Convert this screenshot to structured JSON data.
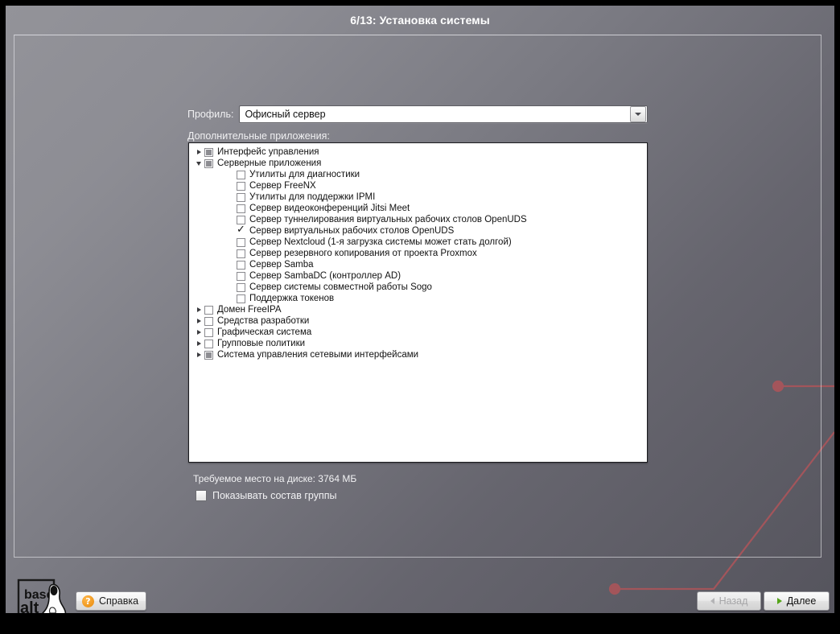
{
  "window": {
    "title": "6/13: Установка системы"
  },
  "form": {
    "profile_label": "Профиль:",
    "profile_value": "Офисный сервер",
    "combo_icon": "chevron-down-icon",
    "apps_label": "Дополнительные приложения:",
    "disk_space_text": "Требуемое место на диске: 3764 МБ",
    "show_group_label": "Показывать состав группы",
    "show_group_checked": false
  },
  "tree": [
    {
      "label": "Интерфейс управления",
      "level": 0,
      "twisty": "right",
      "state": "partial"
    },
    {
      "label": "Серверные приложения",
      "level": 0,
      "twisty": "down",
      "state": "partial"
    },
    {
      "label": "Утилиты для диагностики",
      "level": 1,
      "twisty": "none",
      "state": "unchecked"
    },
    {
      "label": "Сервер FreeNX",
      "level": 1,
      "twisty": "none",
      "state": "unchecked"
    },
    {
      "label": "Утилиты для поддержки IPMI",
      "level": 1,
      "twisty": "none",
      "state": "unchecked"
    },
    {
      "label": "Сервер видеоконференций Jitsi Meet",
      "level": 1,
      "twisty": "none",
      "state": "unchecked"
    },
    {
      "label": "Сервер туннелирования виртуальных рабочих столов OpenUDS",
      "level": 1,
      "twisty": "none",
      "state": "unchecked"
    },
    {
      "label": "Сервер виртуальных рабочих столов OpenUDS",
      "level": 1,
      "twisty": "none",
      "state": "checked"
    },
    {
      "label": "Сервер Nextcloud (1-я загрузка системы может стать долгой)",
      "level": 1,
      "twisty": "none",
      "state": "unchecked"
    },
    {
      "label": "Сервер резервного копирования от проекта Proxmox",
      "level": 1,
      "twisty": "none",
      "state": "unchecked"
    },
    {
      "label": "Сервер Samba",
      "level": 1,
      "twisty": "none",
      "state": "unchecked"
    },
    {
      "label": "Сервер SambaDC (контроллер AD)",
      "level": 1,
      "twisty": "none",
      "state": "unchecked"
    },
    {
      "label": "Сервер системы совместной работы Sogo",
      "level": 1,
      "twisty": "none",
      "state": "unchecked"
    },
    {
      "label": "Поддержка токенов",
      "level": 1,
      "twisty": "none",
      "state": "unchecked"
    },
    {
      "label": "Домен FreeIPA",
      "level": 0,
      "twisty": "right",
      "state": "unchecked"
    },
    {
      "label": "Средства разработки",
      "level": 0,
      "twisty": "right",
      "state": "unchecked"
    },
    {
      "label": "Графическая система",
      "level": 0,
      "twisty": "right",
      "state": "unchecked"
    },
    {
      "label": "Групповые политики",
      "level": 0,
      "twisty": "right",
      "state": "unchecked"
    },
    {
      "label": "Система управления сетевыми интерфейсами",
      "level": 0,
      "twisty": "right",
      "state": "partial"
    }
  ],
  "footer": {
    "logo_top": "base",
    "logo_bottom": "alt",
    "help_label": "Справка",
    "help_icon": "question-mark-icon",
    "back_label": "Назад",
    "back_icon": "chevron-left-icon",
    "back_disabled": true,
    "next_label": "Далее",
    "next_icon": "chevron-right-icon"
  },
  "colors": {
    "accent_green": "#55a519",
    "accent_orange": "#e88a0c",
    "deco_line": "#a9555a",
    "title_text": "#ffffff"
  }
}
